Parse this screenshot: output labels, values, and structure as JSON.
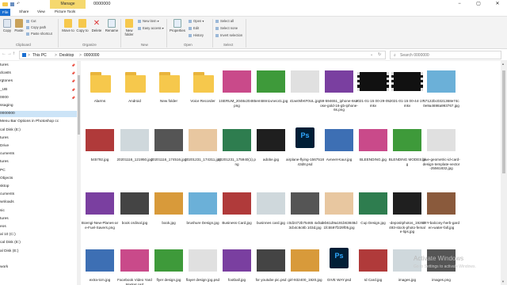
{
  "window": {
    "title": "0000000",
    "manage_tab": "Manage",
    "controls": [
      "−",
      "▢",
      "✕"
    ]
  },
  "menubar": {
    "file": "File",
    "share": "Share",
    "view": "View",
    "picture_tools": "Picture Tools"
  },
  "ribbon": {
    "copy": "Copy",
    "paste": "Paste",
    "cut": "Cut",
    "copy_path": "Copy path",
    "paste_shortcut": "Paste shortcut",
    "clipboard": "Clipboard",
    "move_to": "Move to",
    "copy_to": "Copy to",
    "delete": "Delete",
    "rename": "Rename",
    "organize": "Organize",
    "new_folder": "New folder",
    "new_item": "New item ▾",
    "easy_access": "Easy access ▾",
    "new_group": "New",
    "properties": "Properties",
    "open": "Open ▾",
    "edit": "Edit",
    "history": "History",
    "open_group": "Open",
    "select_all": "Select all",
    "select_none": "Select none",
    "invert_selection": "Invert selection",
    "select_group": "Select"
  },
  "address": {
    "crumbs": [
      "This PC",
      "Desktop",
      "0000000"
    ],
    "sep": ">",
    "back": "←",
    "forward": "→",
    "up": "↑",
    "dropdown": "⌄",
    "refresh": "↻",
    "search_placeholder": "Search 0000000"
  },
  "navpane": {
    "items": [
      {
        "label": "tures"
      },
      {
        "label": "dcasts"
      },
      {
        "label": "rgtones"
      },
      {
        "label": "_UB"
      },
      {
        "label": "0000"
      },
      {
        "label": "ssaging"
      },
      {
        "label": "0000000"
      },
      {
        "label": "Menu Bar Options in Photoshop cc"
      },
      {
        "label": "cal Disk (E:)"
      },
      {
        "label": "tures"
      },
      {
        "label": "Drive"
      },
      {
        "label": "cuments"
      },
      {
        "label": "tures"
      },
      {
        "label": "PC"
      },
      {
        "label": "Objects"
      },
      {
        "label": "sktop"
      },
      {
        "label": "cuments"
      },
      {
        "label": "wnloads"
      },
      {
        "label": "sic"
      },
      {
        "label": "tures"
      },
      {
        "label": "eos"
      },
      {
        "label": "al 10 (C:)"
      },
      {
        "label": "cal Disk (E:)"
      },
      {
        "label": "al Disk (E:)"
      },
      {
        "label": ""
      },
      {
        "label": "work"
      }
    ]
  },
  "files": [
    {
      "name": "Alarms",
      "kind": "folder"
    },
    {
      "name": "Android",
      "kind": "folder"
    },
    {
      "name": "New folder",
      "kind": "folder"
    },
    {
      "name": "Voice Recorder",
      "kind": "folder"
    },
    {
      "name": "1SERUM_2048x2048.png",
      "kind": "image"
    },
    {
      "name": "5em58m1vnec41.jpg",
      "kind": "image"
    },
    {
      "name": "41wsNhKF0UL.jpg",
      "kind": "image"
    },
    {
      "name": "59-594651_iphone-6s-rose-gold-16-gb-iphone-6s.png",
      "kind": "image"
    },
    {
      "name": "2021-01-15 00-29-05.mkv",
      "kind": "video"
    },
    {
      "name": "2021-01-15 00-44-17.mkv",
      "kind": "video"
    },
    {
      "name": "67122bc0321368e74c0e9a4698a993767.jpg",
      "kind": "image"
    },
    {
      "name": "545792.jpg",
      "kind": "image"
    },
    {
      "name": "20201116_121950.jpg",
      "kind": "image"
    },
    {
      "name": "20201116_174516.jpg",
      "kind": "image"
    },
    {
      "name": "20201231_174311.jpg",
      "kind": "image"
    },
    {
      "name": "20201231_175940(1).png",
      "kind": "image"
    },
    {
      "name": "adobe.jpg",
      "kind": "image"
    },
    {
      "name": "airplane-flying-156751843d8.psd",
      "kind": "psd"
    },
    {
      "name": "Avneet-Kaur.jpg",
      "kind": "image"
    },
    {
      "name": "BLEENDING.jpg",
      "kind": "image"
    },
    {
      "name": "BLENDING MODES.jpg",
      "kind": "image"
    },
    {
      "name": "blue-geometric-id-card-design-template-vector-25561832.jpg",
      "kind": "image"
    },
    {
      "name": "Boengi-New-Planes-are-Fuel-Savers.png",
      "kind": "image"
    },
    {
      "name": "book ordinal.jpg",
      "kind": "image"
    },
    {
      "name": "book.jpg",
      "kind": "image"
    },
    {
      "name": "brushure Design.jpg",
      "kind": "image"
    },
    {
      "name": "Business Card.jpg",
      "kind": "image"
    },
    {
      "name": "businnes card.jpg",
      "kind": "image"
    },
    {
      "name": "c0d2472b75465 4afcd3cb4c6c8b 103d.jpg",
      "kind": "image"
    },
    {
      "name": "ceb61d9a191b63848d1fc5597f229f05.jpg",
      "kind": "image"
    },
    {
      "name": "Cup Design.jpg",
      "kind": "image"
    },
    {
      "name": "-depositphotos_19262493-stock-photo-female-lips.jpg",
      "kind": "image"
    },
    {
      "name": "DIY-balcony-herb-garden-water-fall.jpg",
      "kind": "image"
    },
    {
      "name": "extra-tcm.jpg",
      "kind": "image"
    },
    {
      "name": "Facebook Video Yard Market.psd",
      "kind": "image"
    },
    {
      "name": "flyer design.jpg",
      "kind": "image"
    },
    {
      "name": "flayer design jpg.psd",
      "kind": "image"
    },
    {
      "name": "football.jpg",
      "kind": "image"
    },
    {
      "name": "for youtube pic.psd",
      "kind": "image"
    },
    {
      "name": "girl-932400_1920.jpg",
      "kind": "image"
    },
    {
      "name": "GIVE WAY.psd",
      "kind": "psd"
    },
    {
      "name": "Id Card.jpg",
      "kind": "image"
    },
    {
      "name": "images.jpg",
      "kind": "image"
    },
    {
      "name": "images.png",
      "kind": "image"
    }
  ],
  "colors": {
    "accent": "#0a64d6",
    "selection": "#cce4f7",
    "folder": "#f6c84c",
    "manage_tab": "#f5d86e",
    "psd": "#001e36"
  },
  "watermark": {
    "line1": "Activate Windows",
    "line2": "Go to Settings to activate Windows."
  }
}
